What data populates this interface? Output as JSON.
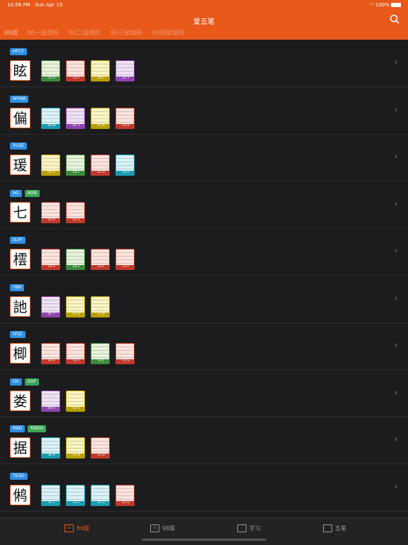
{
  "status_bar": {
    "time": "10:58 PM",
    "date": "Sun Apr 19",
    "battery": "100%"
  },
  "app_title": "爱五笔",
  "tabs": [
    {
      "label": "86版"
    },
    {
      "label": "86一级简码"
    },
    {
      "label": "86二级简码"
    },
    {
      "label": "86三级编码"
    },
    {
      "label": "86四级编码"
    }
  ],
  "rows": [
    {
      "codes": [
        "HFCY"
      ],
      "char": "眩",
      "keys": [
        {
          "label": "21 H",
          "color": "#3a8a3a",
          "bg": "#e6f2da"
        },
        {
          "label": "12 F",
          "color": "#c0392b",
          "bg": "#fde3dc"
        },
        {
          "label": "54 C",
          "color": "#b8a000",
          "bg": "#fbf4c0"
        },
        {
          "label": "41 Y",
          "color": "#8e44ad",
          "bg": "#efe0f5"
        }
      ]
    },
    {
      "codes": [
        "WYNA"
      ],
      "char": "偏",
      "keys": [
        {
          "label": "34 W",
          "color": "#1a9bb0",
          "bg": "#d8f2f7"
        },
        {
          "label": "41 Y",
          "color": "#8e44ad",
          "bg": "#efe0f5"
        },
        {
          "label": "51 N",
          "color": "#b8a000",
          "bg": "#fbf4c0"
        },
        {
          "label": "15 A",
          "color": "#c0392b",
          "bg": "#fde3dc"
        }
      ]
    },
    {
      "codes": [
        "XLGE"
      ],
      "char": "瑗",
      "keys": [
        {
          "label": "55 X",
          "color": "#b8a000",
          "bg": "#fbf4c0"
        },
        {
          "label": "24 L",
          "color": "#3a8a3a",
          "bg": "#e6f2da"
        },
        {
          "label": "11 G",
          "color": "#c0392b",
          "bg": "#fde3dc"
        },
        {
          "label": "33 E",
          "color": "#1a9bb0",
          "bg": "#d8f2f7"
        }
      ]
    },
    {
      "codes": [
        "AG",
        "AGN"
      ],
      "char": "七",
      "keys": [
        {
          "label": "15 A",
          "color": "#c0392b",
          "bg": "#fde3dc"
        },
        {
          "label": "11 G",
          "color": "#c0392b",
          "bg": "#fde3dc"
        }
      ]
    },
    {
      "codes": [
        "SLFF"
      ],
      "char": "橒",
      "keys": [
        {
          "label": "14 S",
          "color": "#c0392b",
          "bg": "#fde3dc"
        },
        {
          "label": "24 L",
          "color": "#3a8a3a",
          "bg": "#e6f2da"
        },
        {
          "label": "12 F",
          "color": "#c0392b",
          "bg": "#fde3dc"
        },
        {
          "label": "12 F",
          "color": "#c0392b",
          "bg": "#fde3dc"
        }
      ]
    },
    {
      "codes": [
        "YBN"
      ],
      "char": "訑",
      "keys": [
        {
          "label": "41 Y",
          "color": "#8e44ad",
          "bg": "#efe0f5"
        },
        {
          "label": "52 B",
          "color": "#b8a000",
          "bg": "#fbf4c0"
        },
        {
          "label": "51 N",
          "color": "#b8a000",
          "bg": "#fbf4c0"
        }
      ]
    },
    {
      "codes": [
        "SFJG"
      ],
      "char": "楖",
      "keys": [
        {
          "label": "14 S",
          "color": "#c0392b",
          "bg": "#fde3dc"
        },
        {
          "label": "12 F",
          "color": "#c0392b",
          "bg": "#fde3dc"
        },
        {
          "label": "22 J",
          "color": "#3a8a3a",
          "bg": "#e6f2da"
        },
        {
          "label": "11 G",
          "color": "#c0392b",
          "bg": "#fde3dc"
        }
      ]
    },
    {
      "codes": [
        "OV",
        "OVF"
      ],
      "char": "娄",
      "keys": [
        {
          "label": "44 O",
          "color": "#8e44ad",
          "bg": "#efe0f5"
        },
        {
          "label": "53 V",
          "color": "#b8a000",
          "bg": "#fbf4c0"
        }
      ]
    },
    {
      "codes": [
        "RND",
        "RNDG"
      ],
      "char": "据",
      "keys": [
        {
          "label": "32 R",
          "color": "#1a9bb0",
          "bg": "#d8f2f7"
        },
        {
          "label": "51 N",
          "color": "#b8a000",
          "bg": "#fbf4c0"
        },
        {
          "label": "13 D",
          "color": "#c0392b",
          "bg": "#fde3dc"
        }
      ]
    },
    {
      "codes": [
        "TEQG"
      ],
      "char": "鸺",
      "keys": [
        {
          "label": "31 T",
          "color": "#1a9bb0",
          "bg": "#d8f2f7"
        },
        {
          "label": "33 E",
          "color": "#1a9bb0",
          "bg": "#d8f2f7"
        },
        {
          "label": "35 Q",
          "color": "#1a9bb0",
          "bg": "#d8f2f7"
        },
        {
          "label": "11 G",
          "color": "#c0392b",
          "bg": "#fde3dc"
        }
      ]
    }
  ],
  "bottom_nav": [
    {
      "label": "86版",
      "icon": "86",
      "active": true
    },
    {
      "label": "98版",
      "icon": "98",
      "active": false
    },
    {
      "label": "学习",
      "icon": "book",
      "active": false
    },
    {
      "label": "五笔",
      "icon": "wubi",
      "active": false
    }
  ]
}
